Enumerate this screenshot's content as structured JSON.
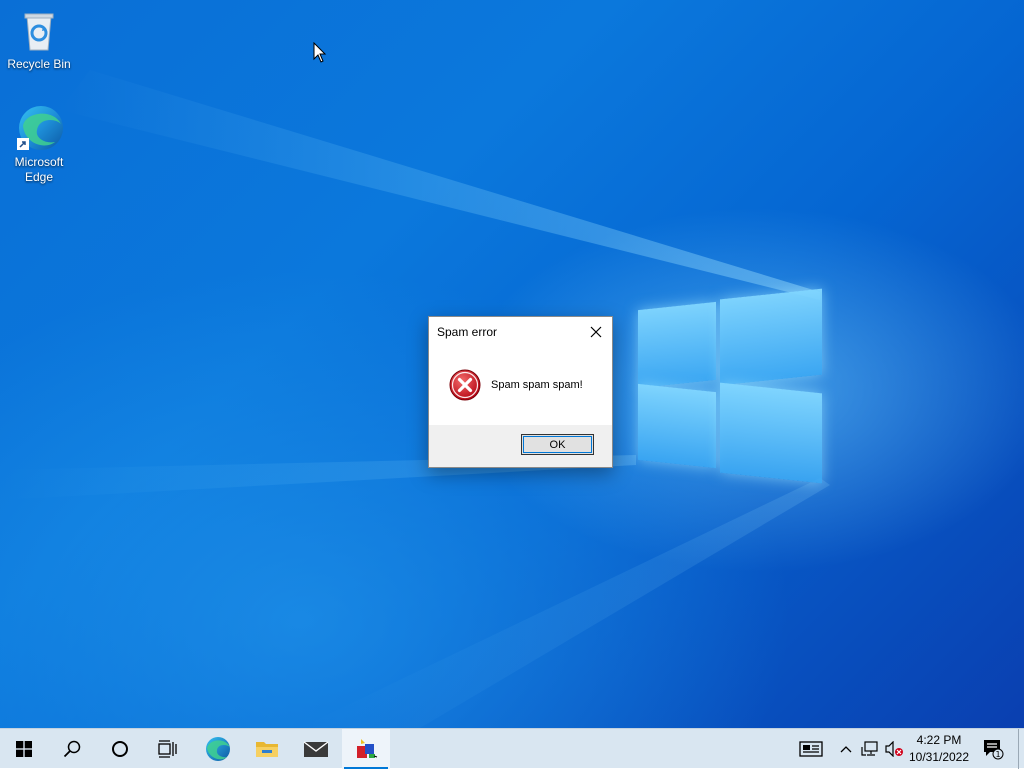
{
  "desktop": {
    "icons": [
      {
        "label": "Recycle Bin",
        "icon": "recycle-bin-icon"
      },
      {
        "label": "Microsoft\nEdge",
        "label_line1": "Microsoft",
        "label_line2": "Edge",
        "icon": "edge-icon"
      }
    ]
  },
  "dialog": {
    "title": "Spam error",
    "message": "Spam spam spam!",
    "ok_label": "OK",
    "icon": "error-icon"
  },
  "taskbar": {
    "buttons": [
      {
        "name": "start",
        "icon": "windows-start-icon"
      },
      {
        "name": "search",
        "icon": "search-icon"
      },
      {
        "name": "cortana",
        "icon": "cortana-circle-icon"
      },
      {
        "name": "task-view",
        "icon": "task-view-icon"
      },
      {
        "name": "edge",
        "icon": "edge-icon"
      },
      {
        "name": "file-explorer",
        "icon": "folder-icon"
      },
      {
        "name": "mail",
        "icon": "mail-icon"
      },
      {
        "name": "python-app",
        "icon": "python-app-icon",
        "active": true
      }
    ],
    "tray": {
      "news_icon": "news-icon",
      "chevron_icon": "chevron-up-icon",
      "network_icon": "network-icon",
      "volume_icon": "volume-muted-icon",
      "time": "4:22 PM",
      "date": "10/31/2022",
      "notifications_icon": "notification-icon",
      "notifications_count": "1"
    }
  },
  "colors": {
    "accent": "#0078d7",
    "error_red": "#d0021b",
    "taskbar": "#d9e6f1"
  }
}
